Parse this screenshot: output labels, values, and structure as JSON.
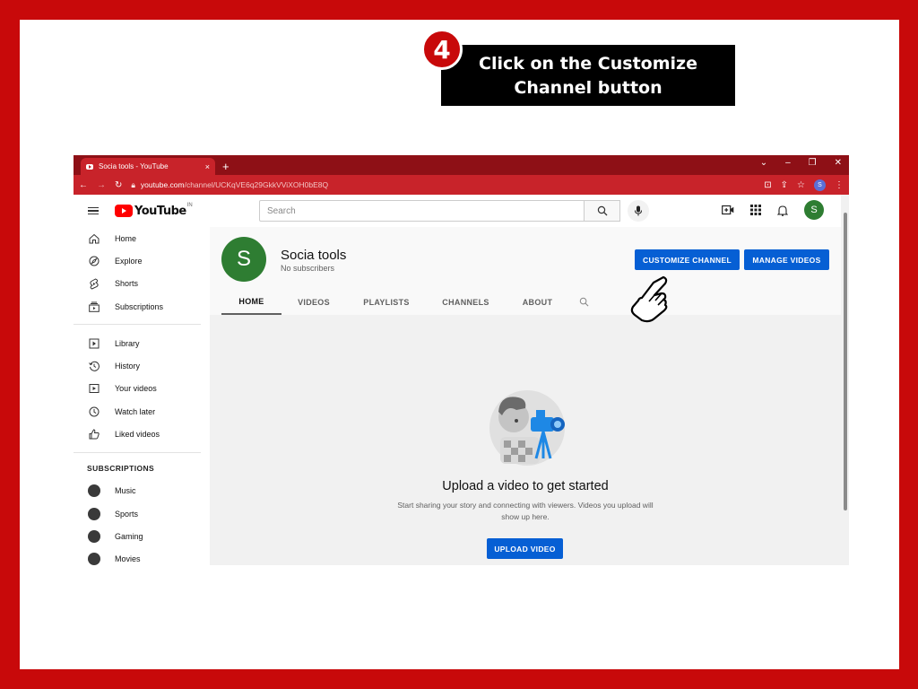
{
  "callout": {
    "step_number": "4",
    "line1": "Click on the Customize",
    "line2": "Channel button"
  },
  "browser": {
    "tab_title": "Socia tools - YouTube",
    "tab_close": "×",
    "new_tab": "+",
    "url_domain": "youtube.com",
    "url_path": "/channel/UCKqVE6q29GkkVViXOH0bE8Q",
    "profile_initial": "S"
  },
  "header": {
    "logo_text": "YouTube",
    "region": "IN",
    "search_placeholder": "Search",
    "avatar_initial": "S"
  },
  "sidebar": {
    "main_items": [
      {
        "label": "Home"
      },
      {
        "label": "Explore"
      },
      {
        "label": "Shorts"
      },
      {
        "label": "Subscriptions"
      }
    ],
    "library_items": [
      {
        "label": "Library"
      },
      {
        "label": "History"
      },
      {
        "label": "Your videos"
      },
      {
        "label": "Watch later"
      },
      {
        "label": "Liked videos"
      }
    ],
    "subscriptions_heading": "SUBSCRIPTIONS",
    "subscriptions": [
      {
        "label": "Music"
      },
      {
        "label": "Sports"
      },
      {
        "label": "Gaming"
      },
      {
        "label": "Movies"
      }
    ]
  },
  "channel": {
    "avatar_initial": "S",
    "name": "Socia tools",
    "subscribers": "No subscribers",
    "customize_label": "CUSTOMIZE CHANNEL",
    "manage_label": "MANAGE VIDEOS",
    "tabs": [
      {
        "label": "HOME"
      },
      {
        "label": "VIDEOS"
      },
      {
        "label": "PLAYLISTS"
      },
      {
        "label": "CHANNELS"
      },
      {
        "label": "ABOUT"
      }
    ]
  },
  "empty_state": {
    "title": "Upload a video to get started",
    "description": "Start sharing your story and connecting with viewers. Videos you upload will show up here.",
    "upload_label": "UPLOAD VIDEO"
  },
  "colors": {
    "frame": "#c8090a",
    "browser_chrome": "#c8232a",
    "youtube_blue": "#065fd4",
    "avatar_green": "#2e7d32"
  }
}
